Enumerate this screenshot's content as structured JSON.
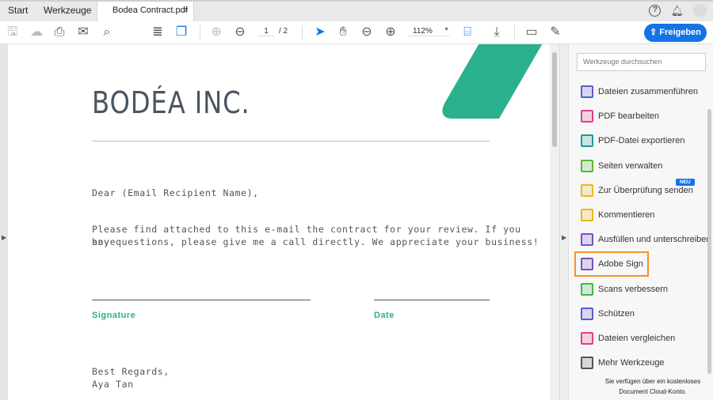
{
  "tabs": {
    "start": "Start",
    "tools": "Werkzeuge",
    "document": "Bodea Contract.pdf",
    "close": "×"
  },
  "toolbar": {
    "page_current": "1",
    "page_total": "/ 2",
    "zoom": "112%",
    "share": "Freigeben"
  },
  "document": {
    "logo": "BODÉA INC.",
    "greeting": "Dear (Email Recipient Name),",
    "body_line1": "Please find attached to this e-mail the contract for your review. If you have",
    "body_line2": "any questions, please give me a call directly. We appreciate your business!",
    "signature_label": "Signature",
    "date_label": "Date",
    "closing": "Best Regards,",
    "name": "Aya Tan"
  },
  "panel": {
    "search_placeholder": "Werkzeuge durchsuchen",
    "new_badge": "NEU",
    "tools": [
      {
        "label": "Dateien zusammenführen",
        "color": "#5b5bd6"
      },
      {
        "label": "PDF bearbeiten",
        "color": "#e0408a"
      },
      {
        "label": "PDF-Datei exportieren",
        "color": "#1c9a9a"
      },
      {
        "label": "Seiten verwalten",
        "color": "#5cb82e"
      },
      {
        "label": "Zur Überprüfung senden",
        "color": "#e8b81a"
      },
      {
        "label": "Kommentieren",
        "color": "#e8b81a"
      },
      {
        "label": "Ausfüllen und unterschreiben",
        "color": "#7a4fc8"
      },
      {
        "label": "Adobe Sign",
        "color": "#7a4fc8"
      },
      {
        "label": "Scans verbessern",
        "color": "#3fb84a"
      },
      {
        "label": "Schützen",
        "color": "#5b5bd6"
      },
      {
        "label": "Dateien vergleichen",
        "color": "#e0408a"
      },
      {
        "label": "Mehr Werkzeuge",
        "color": "#555555"
      }
    ],
    "footer_line1": "Sie verfügen über ein kostenloses",
    "footer_line2": "Document Cloud-Konto."
  },
  "colors": {
    "accent": "#1473e6",
    "brand_green": "#2bb08e",
    "highlight": "#f29423"
  }
}
